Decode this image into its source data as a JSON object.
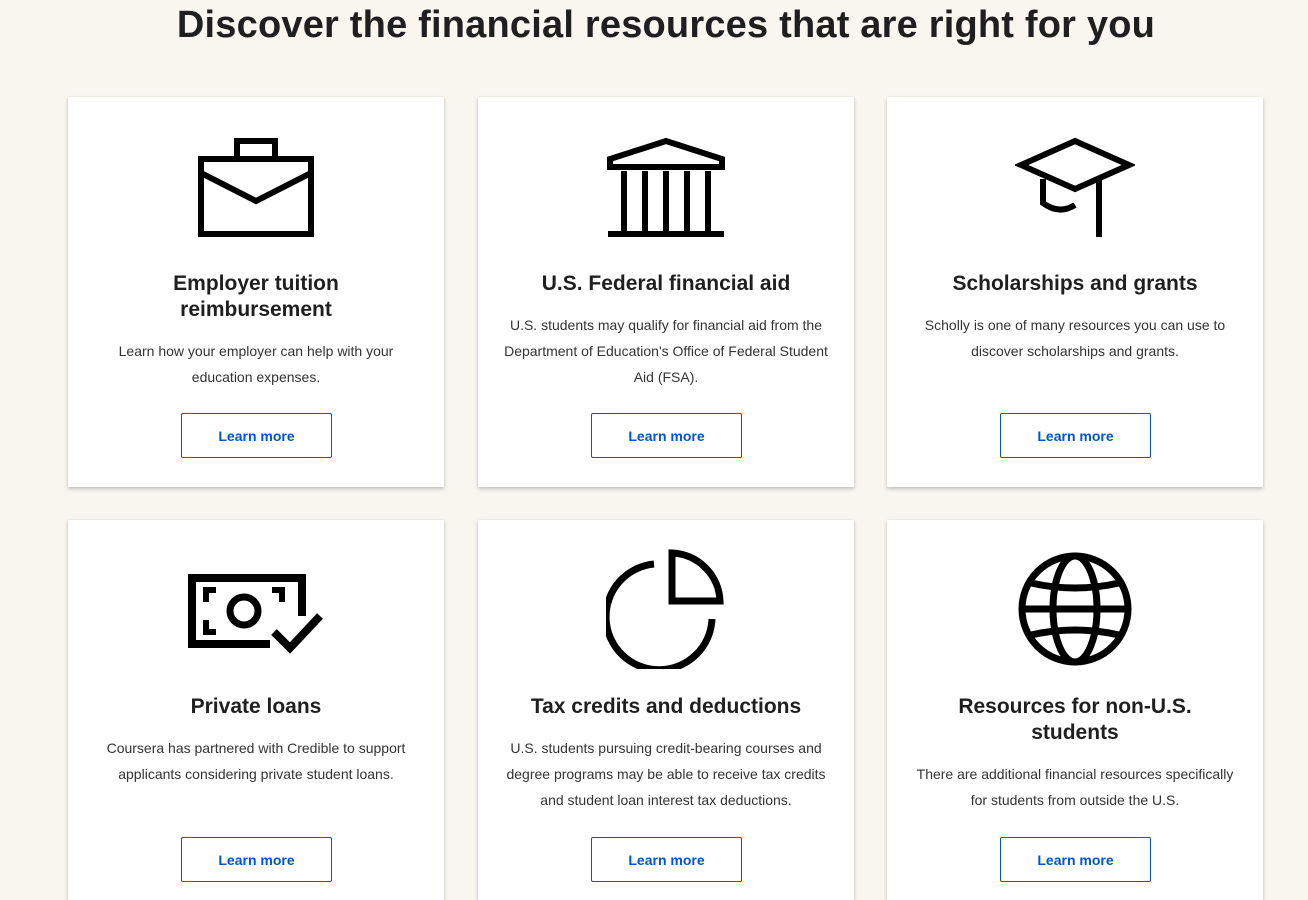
{
  "page": {
    "title": "Discover the financial resources that are right for you"
  },
  "cards": [
    {
      "icon": "briefcase-icon",
      "title": "Employer tuition reimbursement",
      "description": "Learn how your employer can help with your education expenses.",
      "button_label": "Learn more"
    },
    {
      "icon": "government-building-icon",
      "title": "U.S. Federal financial aid",
      "description": "U.S. students may qualify for financial aid from the Department of Education's Office of Federal Student Aid (FSA).",
      "button_label": "Learn more"
    },
    {
      "icon": "graduation-cap-icon",
      "title": "Scholarships and grants",
      "description": "Scholly is one of many resources you can use to discover scholarships and grants.",
      "button_label": "Learn more"
    },
    {
      "icon": "money-check-icon",
      "title": "Private loans",
      "description": "Coursera has partnered with Credible to support applicants considering private student loans.",
      "button_label": "Learn more"
    },
    {
      "icon": "pie-chart-icon",
      "title": "Tax credits and deductions",
      "description": "U.S. students pursuing credit-bearing courses and degree programs may be able to receive tax credits and student loan interest tax deductions.",
      "button_label": "Learn more"
    },
    {
      "icon": "globe-icon",
      "title": "Resources for non-U.S. students",
      "description": "There are additional financial resources specifically for students from outside the U.S.",
      "button_label": "Learn more"
    }
  ],
  "colors": {
    "background": "#f9f6f0",
    "card": "#ffffff",
    "accent": "#0056d2",
    "text": "#1f1f1f"
  }
}
